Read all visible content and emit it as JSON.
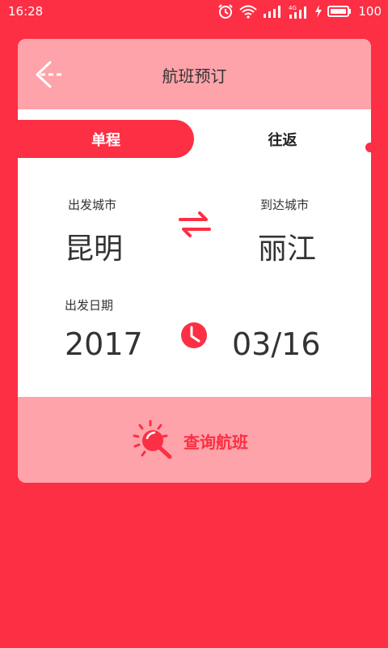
{
  "status_bar": {
    "time": "16:28",
    "battery": "100"
  },
  "header": {
    "title": "航班预订"
  },
  "tabs": [
    {
      "label": "单程",
      "active": true
    },
    {
      "label": "往返",
      "active": false
    }
  ],
  "route": {
    "departure_label": "出发城市",
    "departure_city": "昆明",
    "arrival_label": "到达城市",
    "arrival_city": "丽江"
  },
  "date": {
    "label": "出发日期",
    "year": "2017",
    "month_day": "03/16"
  },
  "search": {
    "label": "查询航班"
  },
  "colors": {
    "accent": "#fc2f44",
    "soft": "#fea3a9",
    "card": "#ffffff",
    "text": "#333333"
  },
  "icons": [
    "alarm-icon",
    "wifi-icon",
    "signal-icon",
    "signal-4g-icon",
    "charging-icon",
    "battery-icon",
    "back-arrow-icon",
    "swap-icon",
    "clock-icon",
    "search-icon"
  ]
}
